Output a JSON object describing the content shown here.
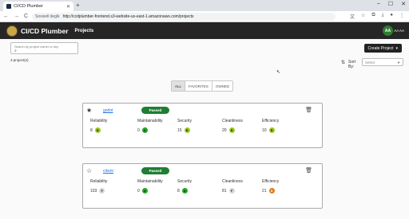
{
  "browser": {
    "tab_title": "CI/CD Plumber",
    "new_tab": "+",
    "security_label": "Sovwell deglk",
    "url": "http://ccdplumber-frontend.s3-website-us-east-1.amazonaws.com/projects",
    "back": "←",
    "forward": "→",
    "reload": "C",
    "minimize": "–",
    "maximize": "☐",
    "close": "✕"
  },
  "header": {
    "brand": "CI/CD Plumber",
    "nav_projects": "Projects",
    "avatar_initials": "AA",
    "username": "AA AA"
  },
  "toolbar": {
    "search_placeholder": "Search by project owner or key",
    "create_button": "Create Project",
    "project_count": "3 project(s)",
    "sort_label": "Sort By:",
    "sort_value": "Select"
  },
  "filters": [
    "ALL",
    "FAVORITES",
    "OWNED"
  ],
  "active_filter": "ALL",
  "metric_labels": [
    "Reliability",
    "Maintainability",
    "Security",
    "Cleanliness",
    "Efficiency"
  ],
  "projects": [
    {
      "name": "godot",
      "status": "Passed",
      "favorite": true,
      "metrics": [
        {
          "value": "8",
          "grade": "B"
        },
        {
          "value": "0",
          "grade": "A"
        },
        {
          "value": "15",
          "grade": "B"
        },
        {
          "value": "20",
          "grade": "B"
        },
        {
          "value": "10",
          "grade": "B"
        }
      ]
    },
    {
      "name": "cikem",
      "status": "Passed",
      "favorite": false,
      "metrics": [
        {
          "value": "103",
          "grade": "F"
        },
        {
          "value": "0",
          "grade": "A"
        },
        {
          "value": "8",
          "grade": "A"
        },
        {
          "value": "81",
          "grade": "F"
        },
        {
          "value": "21",
          "grade": "D"
        }
      ]
    }
  ]
}
